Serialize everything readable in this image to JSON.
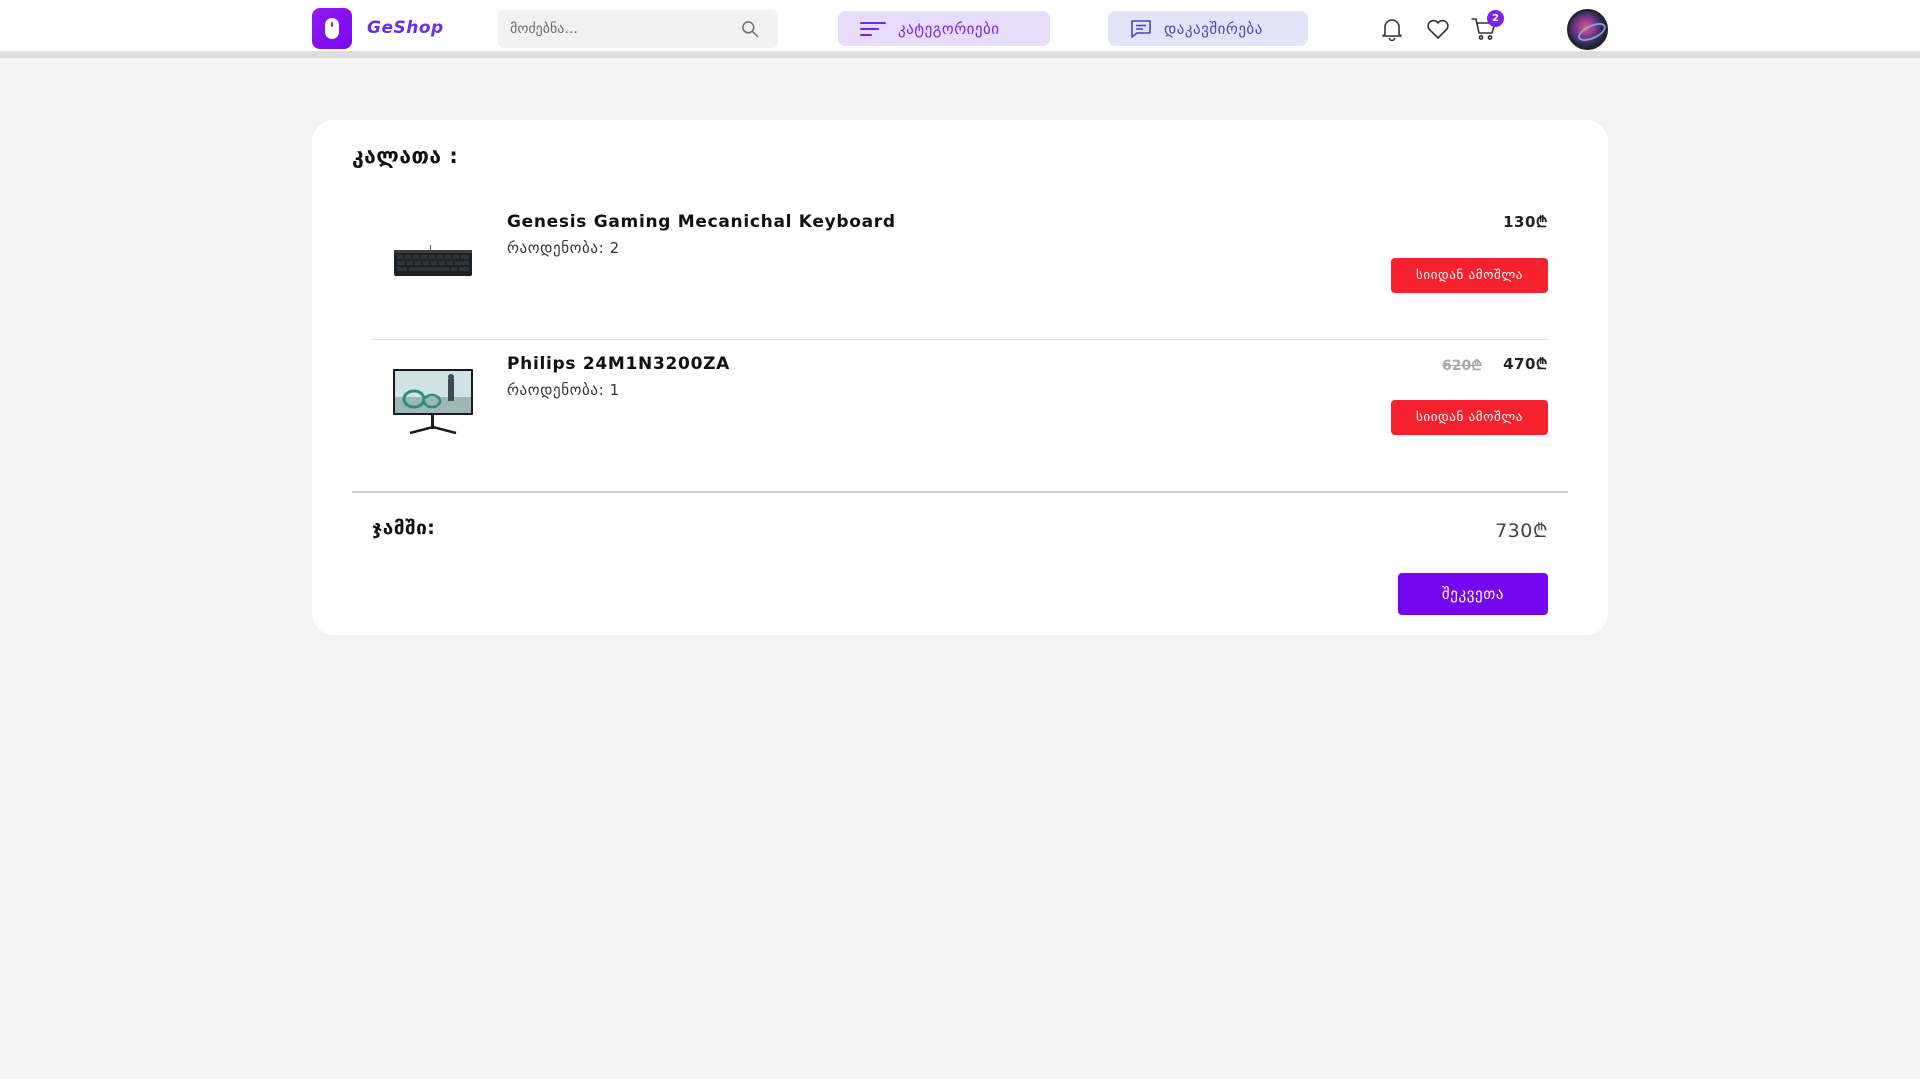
{
  "header": {
    "brand": "GeShop",
    "search": {
      "placeholder": "მოძებნა..."
    },
    "categories_label": "კატეგორიები",
    "contact_label": "დაკავშირება",
    "cart_count": "2"
  },
  "cart": {
    "title": "კალათა :",
    "items": [
      {
        "name": "Genesis Gaming Mecanichal Keyboard",
        "quantity_text": "რაოდენობა: 2",
        "price": "130₾",
        "remove_label": "სიიდან ამოშლა",
        "image": "keyboard"
      },
      {
        "name": "Philips 24M1N3200ZA",
        "quantity_text": "რაოდენობა: 1",
        "old_price": "620₾",
        "price": "470₾",
        "remove_label": "სიიდან ამოშლა",
        "image": "monitor"
      }
    ],
    "total_label": "ჯამში:",
    "total_value": "730₾",
    "buy_label": "შეკვეთა"
  },
  "colors": {
    "accent": "#7506f0",
    "danger": "#f5222d",
    "background": "#f3f3f3"
  },
  "icons": [
    "mouse-logo-icon",
    "search-icon",
    "menu-lines-icon",
    "chat-icon",
    "bell-icon",
    "heart-icon",
    "cart-icon"
  ]
}
